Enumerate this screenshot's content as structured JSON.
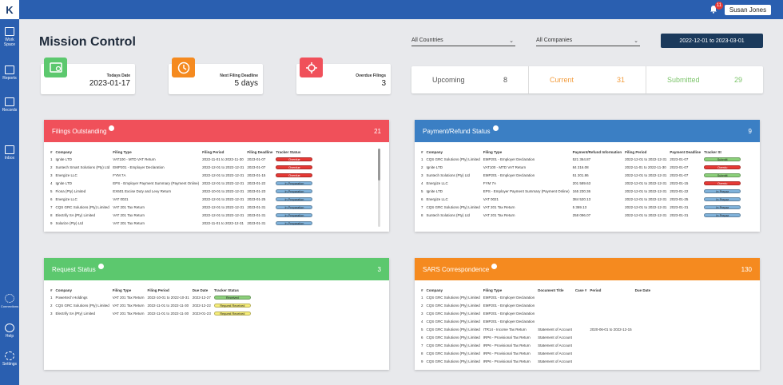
{
  "app": {
    "logo_letter": "K"
  },
  "nav": [
    {
      "label": "Work Space"
    },
    {
      "label": "Reports"
    },
    {
      "label": "Records"
    },
    {
      "label": "Inbox"
    },
    {
      "label": "Connections"
    },
    {
      "label": "Help"
    },
    {
      "label": "Settings"
    }
  ],
  "topbar": {
    "notifications": "11",
    "user": "Susan Jones"
  },
  "page_title": "Mission Control",
  "filters": {
    "country": "All Countries",
    "company": "All Companies",
    "date_range": "2022-12-01 to 2023-03-01"
  },
  "stats": {
    "today": {
      "label": "Todays Date",
      "value": "2023-01-17"
    },
    "deadline": {
      "label": "Next Filing Deadline",
      "value": "5 days"
    },
    "overdue": {
      "label": "Overdue Filings",
      "value": "3"
    }
  },
  "status_summary": [
    {
      "label": "Upcoming",
      "value": "8",
      "color": "#555555"
    },
    {
      "label": "Current",
      "value": "31",
      "color": "#f39c3c"
    },
    {
      "label": "Submitted",
      "value": "29",
      "color": "#7cc46a"
    }
  ],
  "colors": {
    "red": "#f0505a",
    "blue": "#3b7fc4",
    "green": "#5cc86e",
    "orange": "#f58a1f",
    "navy": "#1b3a5c"
  },
  "filings_outstanding": {
    "title": "Filings Outstanding",
    "count": "21",
    "columns": [
      "#",
      "Company",
      "Filing Type",
      "Filing Period",
      "Filing Deadline",
      "Tracker Status"
    ],
    "rows": [
      [
        "1",
        "Ignite LTD",
        "VAT100 - MTD VAT Return",
        "2022-11-01 to 2022-11-30",
        "2023-01-07",
        "Overdue"
      ],
      [
        "2",
        "Suntech Smart Solutions (Pty) Ltd",
        "EMP201 - Employer Declaration",
        "2022-12-01 to 2022-12-31",
        "2023-01-07",
        "Overdue"
      ],
      [
        "3",
        "Energize LLC",
        "FYM 7A",
        "2022-12-01 to 2022-12-31",
        "2023-01-15",
        "Overdue"
      ],
      [
        "4",
        "Ignite LTD",
        "EPS - Employer Payment Summary (Payment Online)",
        "2022-12-01 to 2022-12-31",
        "2023-01-22",
        "In Preparation"
      ],
      [
        "5",
        "Fiona (Pty) Limited",
        "EX601 Excise Duty and Levy Return",
        "2022-10-01 to 2022-12-31",
        "2023-01-23",
        "In Preparation"
      ],
      [
        "6",
        "Energize LLC",
        "VAT 0021",
        "2022-12-01 to 2022-12-31",
        "2023-01-25",
        "In Preparation"
      ],
      [
        "7",
        "CQS GRC Solutions (Pty) Limited",
        "VAT 201 Tax Return",
        "2022-12-01 to 2022-12-31",
        "2023-01-31",
        "In Preparation"
      ],
      [
        "8",
        "Electrify SA (Pty) Limited",
        "VAT 201 Tax Return",
        "2022-12-01 to 2022-12-31",
        "2023-01-31",
        "In Preparation"
      ],
      [
        "9",
        "Solarize (Pty) Ltd",
        "VAT 201 Tax Return",
        "2022-11-01 to 2022-12-31",
        "2023-01-31",
        "In Preparation"
      ]
    ]
  },
  "payment_refund": {
    "title": "Payment/Refund Status",
    "count": "9",
    "columns": [
      "#",
      "Company",
      "Filing Type",
      "Payment/Refund Information",
      "Filing Period",
      "Payment Deadline",
      "Tracker St"
    ],
    "rows": [
      [
        "1",
        "CQS GRC Solutions (Pty) Limited",
        "EMP201 - Employer Declaration",
        "521 364.87",
        "2022-12-01 to 2022-12-31",
        "2023-01-07",
        "Submitt"
      ],
      [
        "2",
        "Ignite LTD",
        "VAT100 - MTD VAT Return",
        "84 216.08",
        "2022-11-01 to 2022-11-30",
        "2023-01-07",
        "Overdu"
      ],
      [
        "3",
        "Suntech Solutions (Pty) Ltd",
        "EMP201 - Employer Declaration",
        "51 201.86",
        "2022-12-01 to 2022-12-31",
        "2023-01-07",
        "Submitt"
      ],
      [
        "4",
        "Energize LLC",
        "FYM 7A",
        "201 589.63",
        "2022-12-01 to 2022-12-31",
        "2023-01-15",
        "Overdu"
      ],
      [
        "5",
        "Ignite LTD",
        "EPS - Employer Payment Summary (Payment Online)",
        "165 230.36",
        "2022-12-01 to 2022-12-31",
        "2023-01-22",
        "In Prepar"
      ],
      [
        "6",
        "Energize LLC",
        "VAT 0021",
        "384 520.13",
        "2022-12-01 to 2022-12-31",
        "2023-01-25",
        "In Prepar"
      ],
      [
        "7",
        "CQS GRC Solutions (Pty) Limited",
        "VAT 201 Tax Return",
        "5 369.13",
        "2022-12-01 to 2022-12-31",
        "2023-01-31",
        "In Prepar"
      ],
      [
        "8",
        "Suntech Solutions (Pty) Ltd",
        "VAT 201 Tax Return",
        "258 096.07",
        "2022-12-01 to 2022-12-31",
        "2023-01-31",
        "In Prepar"
      ]
    ]
  },
  "request_status": {
    "title": "Request Status",
    "count": "3",
    "columns": [
      "#",
      "Company",
      "Filing Type",
      "Filing Period",
      "Due Date",
      "Tracker Status"
    ],
    "rows": [
      [
        "1",
        "Powertech Holdings",
        "VAT 201 Tax Return",
        "2022-10-01 to 2022-10-31",
        "2022-12-27",
        "Received"
      ],
      [
        "2",
        "CQS GRC Solutions (Pty) Limited",
        "VAT 201 Tax Return",
        "2022-11-01 to 2022-11-30",
        "2022-12-22",
        "Request Received"
      ],
      [
        "3",
        "Electrify SA (Pty) Limited",
        "VAT 201 Tax Return",
        "2022-11-01 to 2022-11-30",
        "2023-01-23",
        "Request Received"
      ]
    ]
  },
  "sars": {
    "title": "SARS Correspondence",
    "count": "130",
    "columns": [
      "#",
      "Company",
      "Filing Type",
      "Document Title",
      "Case #",
      "Period",
      "Due Date"
    ],
    "rows": [
      [
        "1",
        "CQS GRC Solutions (Pty) Limited",
        "EMP201 - Employer Declaration",
        "",
        "",
        "",
        ""
      ],
      [
        "2",
        "CQS GRC Solutions (Pty) Limited",
        "EMP201 - Employer Declaration",
        "",
        "",
        "",
        ""
      ],
      [
        "3",
        "CQS GRC Solutions (Pty) Limited",
        "EMP201 - Employer Declaration",
        "",
        "",
        "",
        ""
      ],
      [
        "4",
        "CQS GRC Solutions (Pty) Limited",
        "EMP201 - Employer Declaration",
        "",
        "",
        "",
        ""
      ],
      [
        "5",
        "CQS GRC Solutions (Pty) Limited",
        "ITR14 - Income Tax Return",
        "Statement of Account",
        "",
        "2020-06-01 to 2022-12-15",
        ""
      ],
      [
        "6",
        "CQS GRC Solutions (Pty) Limited",
        "IRP6 - Provisional Tax Return",
        "Statement of Account",
        "",
        "",
        ""
      ],
      [
        "7",
        "CQS GRC Solutions (Pty) Limited",
        "IRP6 - Provisional Tax Return",
        "Statement of Account",
        "",
        "",
        ""
      ],
      [
        "8",
        "CQS GRC Solutions (Pty) Limited",
        "IRP6 - Provisional Tax Return",
        "Statement of Account",
        "",
        "",
        ""
      ],
      [
        "9",
        "CQS GRC Solutions (Pty) Limited",
        "IRP6 - Provisional Tax Return",
        "Statement of Account",
        "",
        "",
        ""
      ]
    ]
  }
}
